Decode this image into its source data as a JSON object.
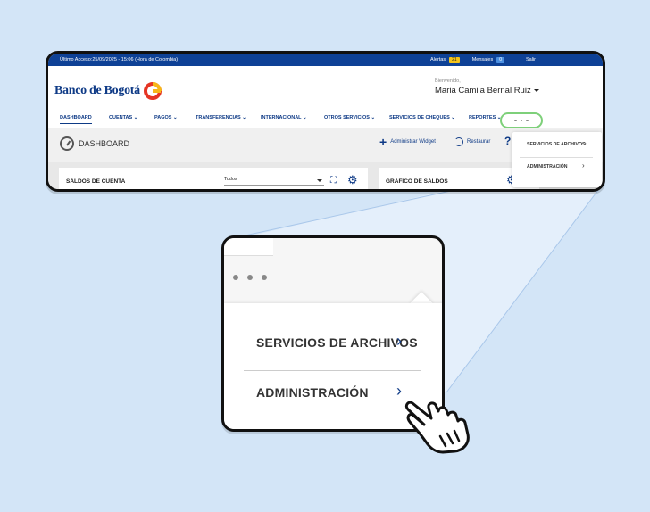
{
  "topbar": {
    "last_access": "Último Acceso:25/09/2025 - 15:06 (Hora de Colombia)",
    "alerts_label": "Alertas",
    "alerts_count": "21",
    "messages_label": "Mensajes",
    "messages_count": "0",
    "exit_label": "Salir"
  },
  "brand": {
    "name": "Banco de Bogotá"
  },
  "user": {
    "welcome": "Bienvenido,",
    "name": "Maria Camila Bernal Ruiz"
  },
  "nav": {
    "items": [
      {
        "label": "DASHBOARD"
      },
      {
        "label": "CUENTAS"
      },
      {
        "label": "PAGOS"
      },
      {
        "label": "TRANSFERENCIAS"
      },
      {
        "label": "INTERNACIONAL"
      },
      {
        "label": "OTROS SERVICIOS"
      },
      {
        "label": "SERVICIOS DE CHEQUES"
      },
      {
        "label": "REPORTES"
      }
    ]
  },
  "subbar": {
    "title": "DASHBOARD",
    "admin_widget": "Administrar Widget",
    "restore": "Restaurar",
    "help": "?"
  },
  "widgets": {
    "saldos_title": "SALDOS DE CUENTA",
    "saldos_filter": "Todos",
    "grafico_title": "GRÁFICO DE SALDOS"
  },
  "dropdown": {
    "option1": "SERVICIOS DE ARCHIVOS",
    "option2": "ADMINISTRACIÓN"
  },
  "colors": {
    "brand_blue": "#0e4196",
    "highlight_green": "#7ed07a",
    "alert_yellow": "#f3c319"
  }
}
